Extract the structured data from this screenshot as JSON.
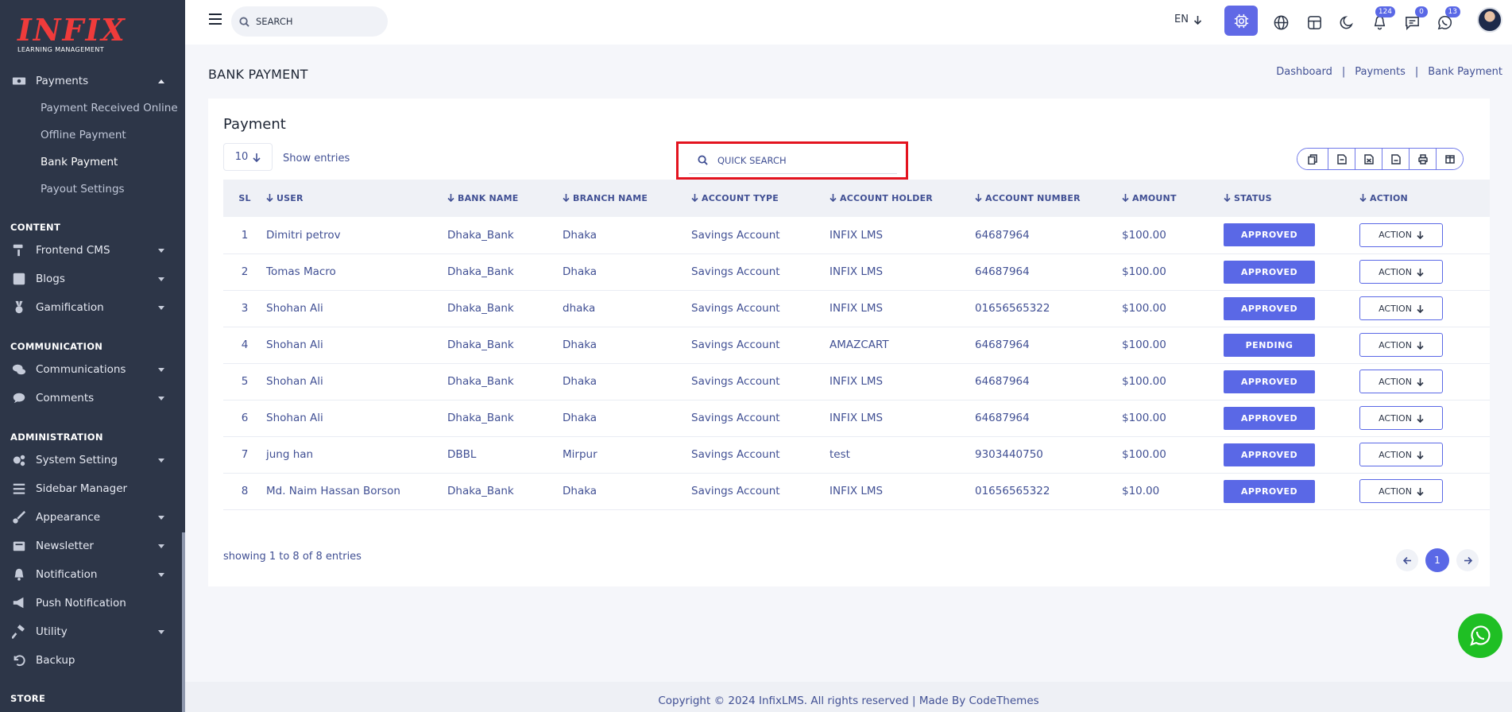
{
  "brand": {
    "logo_text": "INFIX",
    "logo_sub": "LEARNING MANAGEMENT"
  },
  "sidebar": {
    "payments": {
      "label": "Payments",
      "icon": "money-icon"
    },
    "payment_sub": [
      {
        "label": "Payment Received Online"
      },
      {
        "label": "Offline Payment"
      },
      {
        "label": "Bank Payment",
        "active": true
      },
      {
        "label": "Payout Settings"
      }
    ],
    "sections": {
      "content": "CONTENT",
      "communication": "COMMUNICATION",
      "administration": "ADMINISTRATION",
      "store": "STORE"
    },
    "content_items": [
      {
        "label": "Frontend CMS",
        "icon": "paint-roller-icon"
      },
      {
        "label": "Blogs",
        "icon": "edit-icon"
      },
      {
        "label": "Gamification",
        "icon": "medal-icon"
      }
    ],
    "communication_items": [
      {
        "label": "Communications",
        "icon": "chat-bubbles-icon"
      },
      {
        "label": "Comments",
        "icon": "comment-icon"
      }
    ],
    "admin_items": [
      {
        "label": "System Setting",
        "icon": "gears-icon"
      },
      {
        "label": "Sidebar Manager",
        "icon": "list-icon"
      },
      {
        "label": "Appearance",
        "icon": "brush-icon"
      },
      {
        "label": "Newsletter",
        "icon": "newsletter-icon"
      },
      {
        "label": "Notification",
        "icon": "bell-icon"
      },
      {
        "label": "Push Notification",
        "icon": "megaphone-icon"
      },
      {
        "label": "Utility",
        "icon": "hammer-icon"
      },
      {
        "label": "Backup",
        "icon": "undo-icon"
      }
    ]
  },
  "header": {
    "search_placeholder": "SEARCH",
    "language": "EN",
    "badges": {
      "notifications": "124",
      "messages": "0",
      "whatsapp": "13"
    }
  },
  "page": {
    "title": "BANK PAYMENT",
    "breadcrumb": [
      "Dashboard",
      "Payments",
      "Bank Payment"
    ]
  },
  "card": {
    "title": "Payment",
    "entries_value": "10",
    "entries_label": "Show entries",
    "quick_search_placeholder": "QUICK SEARCH",
    "export_buttons": [
      "copy-icon",
      "csv-icon",
      "excel-icon",
      "pdf-icon",
      "print-icon",
      "columns-icon"
    ]
  },
  "table": {
    "columns": [
      "SL",
      "USER",
      "BANK NAME",
      "BRANCH NAME",
      "ACCOUNT TYPE",
      "ACCOUNT HOLDER",
      "ACCOUNT NUMBER",
      "AMOUNT",
      "STATUS",
      "ACTION"
    ],
    "rows": [
      {
        "sl": "1",
        "user": "Dimitri petrov",
        "bank": "Dhaka_Bank",
        "branch": "Dhaka",
        "type": "Savings Account",
        "holder": "INFIX LMS",
        "number": "64687964",
        "amount": "$100.00",
        "status": "APPROVED",
        "action": "ACTION"
      },
      {
        "sl": "2",
        "user": "Tomas Macro",
        "bank": "Dhaka_Bank",
        "branch": "Dhaka",
        "type": "Savings Account",
        "holder": "INFIX LMS",
        "number": "64687964",
        "amount": "$100.00",
        "status": "APPROVED",
        "action": "ACTION"
      },
      {
        "sl": "3",
        "user": "Shohan Ali",
        "bank": "Dhaka_Bank",
        "branch": "dhaka",
        "type": "Savings Account",
        "holder": "INFIX LMS",
        "number": "01656565322",
        "amount": "$100.00",
        "status": "APPROVED",
        "action": "ACTION"
      },
      {
        "sl": "4",
        "user": "Shohan Ali",
        "bank": "Dhaka_Bank",
        "branch": "Dhaka",
        "type": "Savings Account",
        "holder": "AMAZCART",
        "number": "64687964",
        "amount": "$100.00",
        "status": "PENDING",
        "action": "ACTION"
      },
      {
        "sl": "5",
        "user": "Shohan Ali",
        "bank": "Dhaka_Bank",
        "branch": "Dhaka",
        "type": "Savings Account",
        "holder": "INFIX LMS",
        "number": "64687964",
        "amount": "$100.00",
        "status": "APPROVED",
        "action": "ACTION"
      },
      {
        "sl": "6",
        "user": "Shohan Ali",
        "bank": "Dhaka_Bank",
        "branch": "Dhaka",
        "type": "Savings Account",
        "holder": "INFIX LMS",
        "number": "64687964",
        "amount": "$100.00",
        "status": "APPROVED",
        "action": "ACTION"
      },
      {
        "sl": "7",
        "user": "jung han",
        "bank": "DBBL",
        "branch": "Mirpur",
        "type": "Savings Account",
        "holder": "test",
        "number": "9303440750",
        "amount": "$100.00",
        "status": "APPROVED",
        "action": "ACTION"
      },
      {
        "sl": "8",
        "user": "Md. Naim Hassan Borson",
        "bank": "Dhaka_Bank",
        "branch": "Dhaka",
        "type": "Savings Account",
        "holder": "INFIX LMS",
        "number": "01656565322",
        "amount": "$10.00",
        "status": "APPROVED",
        "action": "ACTION"
      }
    ]
  },
  "pagination": {
    "showing": "showing 1 to 8 of 8 entries",
    "current_page": "1"
  },
  "footer": {
    "text": "Copyright © 2024 InfixLMS. All rights reserved | Made By CodeThemes"
  },
  "colors": {
    "accent": "#5a68e6",
    "sidebar_bg": "#2d3648",
    "highlight_border": "#e3131f",
    "whatsapp": "#1fbf24"
  }
}
